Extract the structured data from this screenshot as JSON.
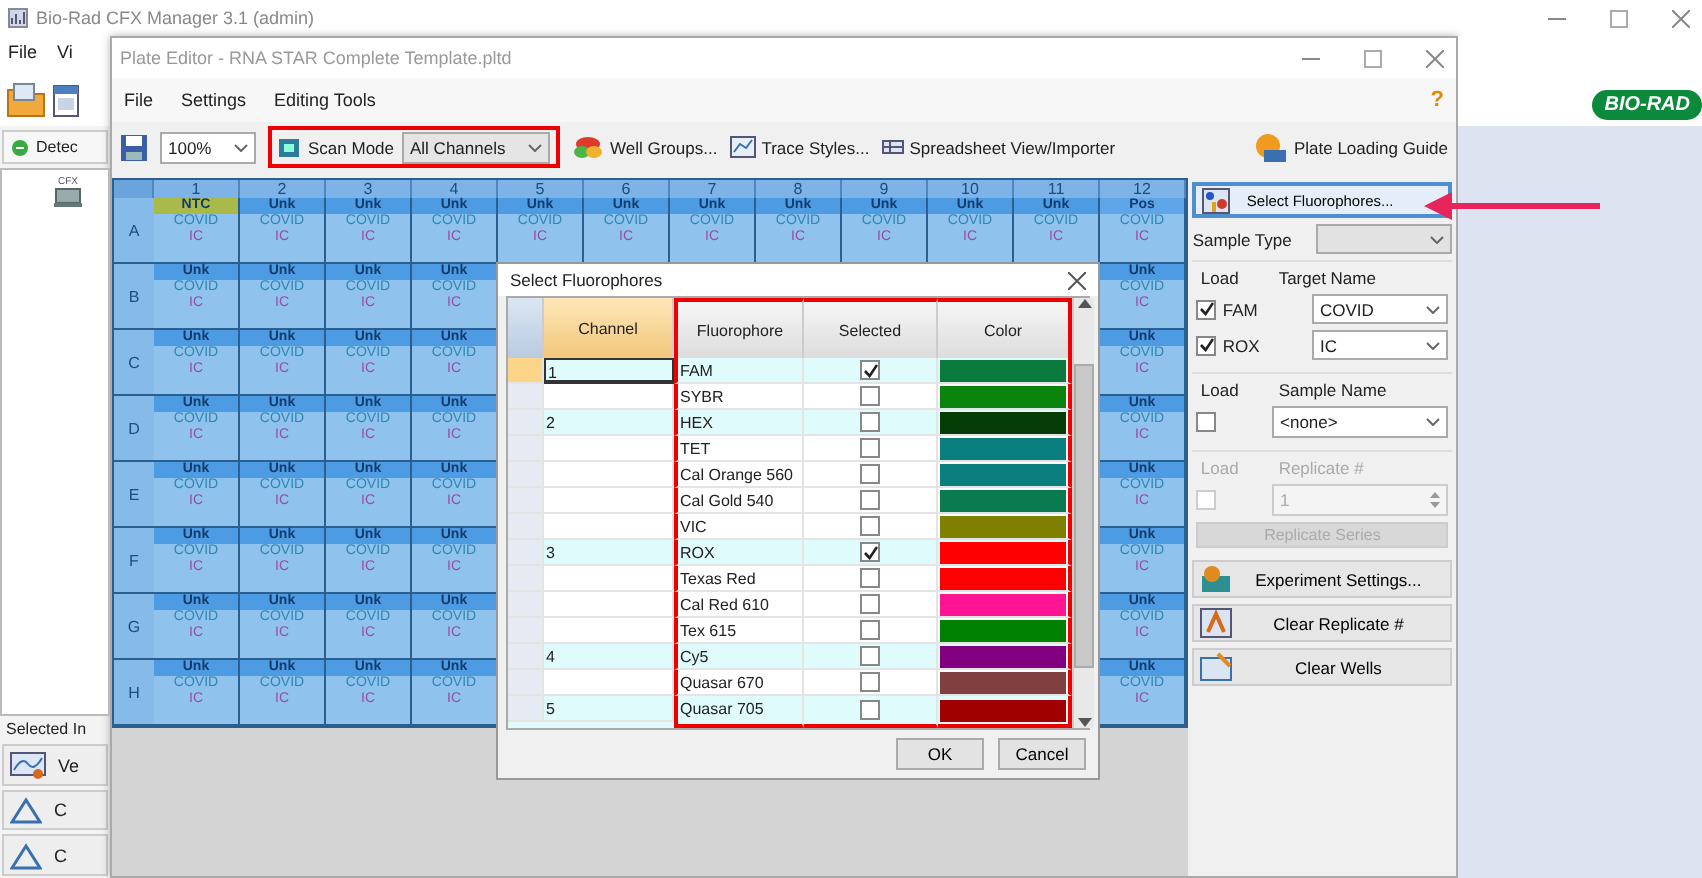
{
  "app": {
    "title": "Bio-Rad CFX Manager 3.1 (admin)",
    "menu": [
      "File",
      "Vi"
    ],
    "toolbar_button": "Detec",
    "tree_item": "CFX",
    "selected_label": "Selected In",
    "side_buttons": [
      "Ve",
      "C",
      "C"
    ],
    "logo": "BIO-RAD"
  },
  "editor": {
    "title": "Plate Editor - RNA STAR Complete Template.pltd",
    "menu": [
      "File",
      "Settings",
      "Editing Tools"
    ],
    "help": "?",
    "zoom": "100%",
    "scan_mode": {
      "label": "Scan Mode",
      "value": "All Channels"
    },
    "tools": [
      "Well Groups...",
      "Trace Styles...",
      "Spreadsheet View/Importer"
    ],
    "guide": "Plate Loading Guide"
  },
  "plate": {
    "columns": [
      "1",
      "2",
      "3",
      "4",
      "5",
      "6",
      "7",
      "8",
      "9",
      "10",
      "11",
      "12"
    ],
    "rows": [
      {
        "label": "A",
        "wells": [
          {
            "kind": "ntc",
            "type": "NTC",
            "targets": [
              "COVID",
              "IC"
            ]
          },
          {
            "kind": "unk",
            "type": "Unk",
            "targets": [
              "COVID",
              "IC"
            ]
          },
          {
            "kind": "unk",
            "type": "Unk",
            "targets": [
              "COVID",
              "IC"
            ]
          },
          {
            "kind": "unk",
            "type": "Unk",
            "targets": [
              "COVID",
              "IC"
            ]
          },
          {
            "kind": "unk",
            "type": "Unk",
            "targets": [
              "COVID",
              "IC"
            ]
          },
          {
            "kind": "unk",
            "type": "Unk",
            "targets": [
              "COVID",
              "IC"
            ]
          },
          {
            "kind": "unk",
            "type": "Unk",
            "targets": [
              "COVID",
              "IC"
            ]
          },
          {
            "kind": "unk",
            "type": "Unk",
            "targets": [
              "COVID",
              "IC"
            ]
          },
          {
            "kind": "unk",
            "type": "Unk",
            "targets": [
              "COVID",
              "IC"
            ]
          },
          {
            "kind": "unk",
            "type": "Unk",
            "targets": [
              "COVID",
              "IC"
            ]
          },
          {
            "kind": "unk",
            "type": "Unk",
            "targets": [
              "COVID",
              "IC"
            ]
          }
        ],
        "last_well": {
          "kind": "pos",
          "type": "Pos",
          "targets": [
            "COVID",
            "IC"
          ]
        }
      },
      {
        "label": "B",
        "wells": [
          {
            "kind": "unk",
            "type": "Unk",
            "targets": [
              "COVID",
              "IC"
            ]
          },
          {
            "kind": "unk",
            "type": "Unk",
            "targets": [
              "COVID",
              "IC"
            ]
          },
          {
            "kind": "unk",
            "type": "Unk",
            "targets": [
              "COVID",
              "IC"
            ]
          },
          {
            "kind": "unk",
            "type": "Unk",
            "targets": [
              "COVID",
              "IC"
            ]
          }
        ],
        "last_well": {
          "kind": "unk",
          "type": "Unk",
          "targets": [
            "COVID",
            "IC"
          ]
        }
      },
      {
        "label": "C",
        "wells": [
          {
            "kind": "unk",
            "type": "Unk",
            "targets": [
              "COVID",
              "IC"
            ]
          },
          {
            "kind": "unk",
            "type": "Unk",
            "targets": [
              "COVID",
              "IC"
            ]
          },
          {
            "kind": "unk",
            "type": "Unk",
            "targets": [
              "COVID",
              "IC"
            ]
          },
          {
            "kind": "unk",
            "type": "Unk",
            "targets": [
              "COVID",
              "IC"
            ]
          }
        ],
        "last_well": {
          "kind": "unk",
          "type": "Unk",
          "targets": [
            "COVID",
            "IC"
          ]
        }
      },
      {
        "label": "D",
        "wells": [
          {
            "kind": "unk",
            "type": "Unk",
            "targets": [
              "COVID",
              "IC"
            ]
          },
          {
            "kind": "unk",
            "type": "Unk",
            "targets": [
              "COVID",
              "IC"
            ]
          },
          {
            "kind": "unk",
            "type": "Unk",
            "targets": [
              "COVID",
              "IC"
            ]
          },
          {
            "kind": "unk",
            "type": "Unk",
            "targets": [
              "COVID",
              "IC"
            ]
          }
        ],
        "last_well": {
          "kind": "unk",
          "type": "Unk",
          "targets": [
            "COVID",
            "IC"
          ]
        }
      },
      {
        "label": "E",
        "wells": [
          {
            "kind": "unk",
            "type": "Unk",
            "targets": [
              "COVID",
              "IC"
            ]
          },
          {
            "kind": "unk",
            "type": "Unk",
            "targets": [
              "COVID",
              "IC"
            ]
          },
          {
            "kind": "unk",
            "type": "Unk",
            "targets": [
              "COVID",
              "IC"
            ]
          },
          {
            "kind": "unk",
            "type": "Unk",
            "targets": [
              "COVID",
              "IC"
            ]
          }
        ],
        "last_well": {
          "kind": "unk",
          "type": "Unk",
          "targets": [
            "COVID",
            "IC"
          ]
        }
      },
      {
        "label": "F",
        "wells": [
          {
            "kind": "unk",
            "type": "Unk",
            "targets": [
              "COVID",
              "IC"
            ]
          },
          {
            "kind": "unk",
            "type": "Unk",
            "targets": [
              "COVID",
              "IC"
            ]
          },
          {
            "kind": "unk",
            "type": "Unk",
            "targets": [
              "COVID",
              "IC"
            ]
          },
          {
            "kind": "unk",
            "type": "Unk",
            "targets": [
              "COVID",
              "IC"
            ]
          }
        ],
        "last_well": {
          "kind": "unk",
          "type": "Unk",
          "targets": [
            "COVID",
            "IC"
          ]
        }
      },
      {
        "label": "G",
        "wells": [
          {
            "kind": "unk",
            "type": "Unk",
            "targets": [
              "COVID",
              "IC"
            ]
          },
          {
            "kind": "unk",
            "type": "Unk",
            "targets": [
              "COVID",
              "IC"
            ]
          },
          {
            "kind": "unk",
            "type": "Unk",
            "targets": [
              "COVID",
              "IC"
            ]
          },
          {
            "kind": "unk",
            "type": "Unk",
            "targets": [
              "COVID",
              "IC"
            ]
          }
        ],
        "last_well": {
          "kind": "unk",
          "type": "Unk",
          "targets": [
            "COVID",
            "IC"
          ]
        }
      },
      {
        "label": "H",
        "wells": [
          {
            "kind": "unk",
            "type": "Unk",
            "targets": [
              "COVID",
              "IC"
            ]
          },
          {
            "kind": "unk",
            "type": "Unk",
            "targets": [
              "COVID",
              "IC"
            ]
          },
          {
            "kind": "unk",
            "type": "Unk",
            "targets": [
              "COVID",
              "IC"
            ]
          },
          {
            "kind": "unk",
            "type": "Unk",
            "targets": [
              "COVID",
              "IC"
            ]
          }
        ],
        "last_well": {
          "kind": "unk",
          "type": "Unk",
          "targets": [
            "COVID",
            "IC"
          ]
        }
      }
    ]
  },
  "dialog": {
    "title": "Select Fluorophores",
    "columns": [
      "Channel",
      "Fluorophore",
      "Selected",
      "Color"
    ],
    "rows": [
      {
        "channel": "1",
        "name": "FAM",
        "selected": true,
        "color": "#0a7a3e"
      },
      {
        "name": "SYBR",
        "selected": false,
        "color": "#0a840a"
      },
      {
        "channel": "2",
        "name": "HEX",
        "selected": false,
        "color": "#063d06"
      },
      {
        "name": "TET",
        "selected": false,
        "color": "#0b7f80"
      },
      {
        "name": "Cal Orange 560",
        "selected": false,
        "color": "#0b7f80"
      },
      {
        "name": "Cal Gold 540",
        "selected": false,
        "color": "#0a7a50"
      },
      {
        "name": "VIC",
        "selected": false,
        "color": "#808000"
      },
      {
        "channel": "3",
        "name": "ROX",
        "selected": true,
        "color": "#ff0000"
      },
      {
        "name": "Texas Red",
        "selected": false,
        "color": "#ff0000"
      },
      {
        "name": "Cal Red 610",
        "selected": false,
        "color": "#ff1493"
      },
      {
        "name": "Tex 615",
        "selected": false,
        "color": "#008000"
      },
      {
        "channel": "4",
        "name": "Cy5",
        "selected": false,
        "color": "#800080"
      },
      {
        "name": "Quasar 670",
        "selected": false,
        "color": "#804040"
      },
      {
        "channel": "5",
        "name": "Quasar 705",
        "selected": false,
        "color": "#a00000"
      }
    ],
    "buttons": [
      "OK",
      "Cancel"
    ]
  },
  "panel": {
    "select_button": "Select Fluorophores...",
    "sample_type": "Sample Type",
    "target_group": {
      "load": "Load",
      "header": "Target Name",
      "rows": [
        {
          "dye": "FAM",
          "checked": true,
          "target": "COVID"
        },
        {
          "dye": "ROX",
          "checked": true,
          "target": "IC"
        }
      ]
    },
    "sample_group": {
      "load": "Load",
      "header": "Sample Name",
      "checked": false,
      "value": "<none>"
    },
    "replicate_group": {
      "load": "Load",
      "header": "Replicate #",
      "checked": false,
      "value": "1",
      "disabled": true,
      "button": "Replicate Series"
    },
    "buttons": [
      {
        "kind": "settings",
        "label": "Experiment Settings..."
      },
      {
        "kind": "replicate",
        "label": "Clear Replicate #"
      },
      {
        "kind": "wells",
        "label": "Clear Wells"
      }
    ]
  }
}
